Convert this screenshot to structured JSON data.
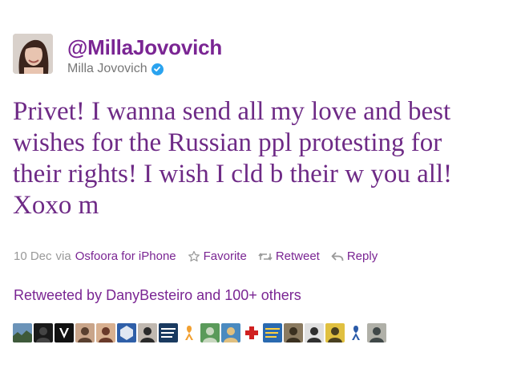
{
  "tweet": {
    "screen_name": "@MillaJovovich",
    "full_name": "Milla Jovovich",
    "verified_icon": "verified-badge-icon",
    "text_lines": [
      "Privet! I wanna send all my love and best",
      "wishes for the Russian ppl protesting for",
      "their rights! I wish I cld b their w you all!",
      "Xoxo m"
    ],
    "date": "10 Dec",
    "via_label": "via",
    "client": "Osfoora for iPhone",
    "actions": {
      "favorite": "Favorite",
      "retweet": "Retweet",
      "reply": "Reply"
    }
  },
  "retweeted_by": {
    "prefix": "Retweeted by",
    "user": "DanyBesteiro",
    "suffix": "and 100+ others"
  },
  "retweeter_avatars": [
    {
      "name": "landscape-avatar",
      "colors": [
        "#6b93b8",
        "#3e5a3a"
      ]
    },
    {
      "name": "dark-avatar",
      "colors": [
        "#1a1a1a",
        "#444444"
      ]
    },
    {
      "name": "v-letter-avatar",
      "colors": [
        "#111111",
        "#ffffff"
      ]
    },
    {
      "name": "portrait-avatar",
      "colors": [
        "#c9a58a",
        "#5a4030"
      ]
    },
    {
      "name": "portrait-avatar",
      "colors": [
        "#d8b090",
        "#6a3a2a"
      ]
    },
    {
      "name": "emblem-avatar",
      "colors": [
        "#2f5fa8",
        "#ffffff"
      ]
    },
    {
      "name": "portrait-avatar",
      "colors": [
        "#c0b8b0",
        "#2a2a2a"
      ]
    },
    {
      "name": "text-avatar",
      "colors": [
        "#1a3a60",
        "#ffffff"
      ]
    },
    {
      "name": "ribbon-avatar",
      "colors": [
        "#ffffff",
        "#f2a030"
      ]
    },
    {
      "name": "statue-avatar",
      "colors": [
        "#5a9a5a",
        "#c8d8c0"
      ]
    },
    {
      "name": "illustration-avatar",
      "colors": [
        "#4a8ac0",
        "#e0c080"
      ]
    },
    {
      "name": "cross-avatar",
      "colors": [
        "#ffffff",
        "#d02020"
      ]
    },
    {
      "name": "text-avatar",
      "colors": [
        "#2a6ab0",
        "#ffd040"
      ]
    },
    {
      "name": "cat-avatar",
      "colors": [
        "#8a7a60",
        "#3a3020"
      ]
    },
    {
      "name": "bw-portrait-avatar",
      "colors": [
        "#e0e0e0",
        "#303030"
      ]
    },
    {
      "name": "yellow-avatar",
      "colors": [
        "#e0c040",
        "#4a4020"
      ]
    },
    {
      "name": "blue-ribbon-avatar",
      "colors": [
        "#ffffff",
        "#2a5aa8"
      ]
    },
    {
      "name": "portrait-avatar",
      "colors": [
        "#b0b0a8",
        "#404848"
      ]
    }
  ],
  "colors": {
    "accent": "#7a2593",
    "tweet_text": "#6e2a86",
    "muted": "#999999",
    "verified": "#2aa3ef"
  }
}
